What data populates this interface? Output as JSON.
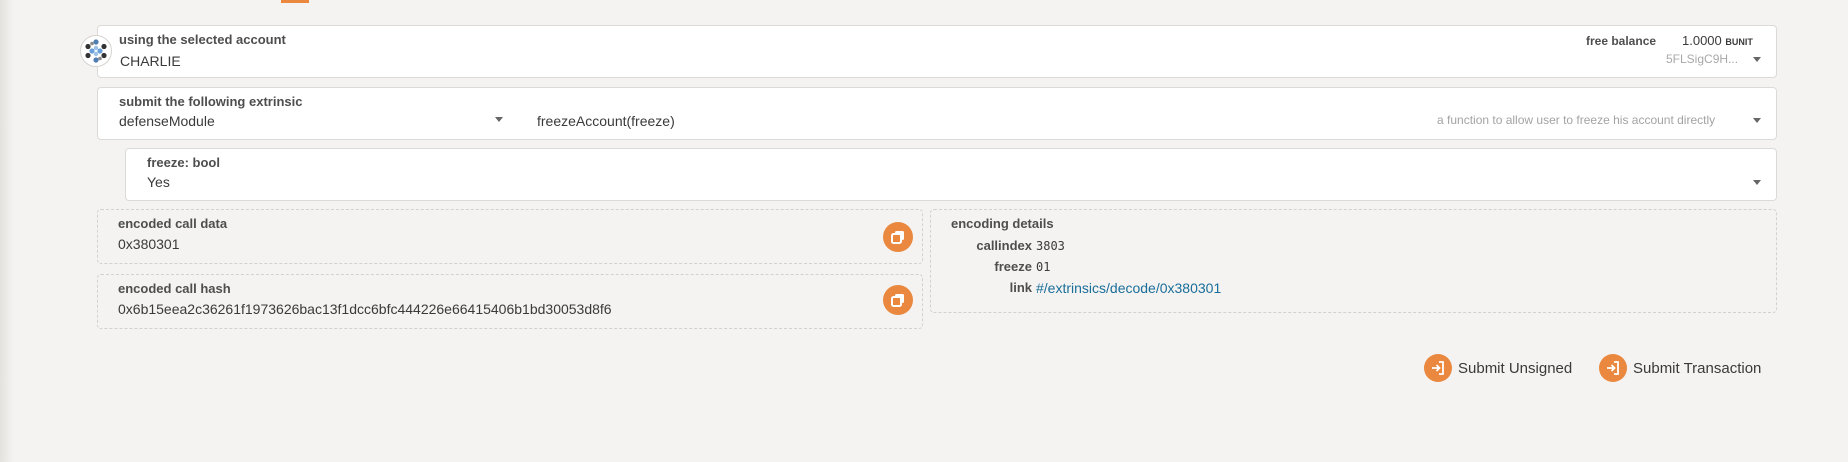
{
  "account": {
    "label": "using the selected account",
    "name": "CHARLIE",
    "free_balance_label": "free balance",
    "balance_value": "1.0000",
    "balance_unit": "BUNIT",
    "address_short": "5FLSigC9H..."
  },
  "extrinsic": {
    "label": "submit the following extrinsic",
    "module": "defenseModule",
    "method": "freezeAccount(freeze)",
    "description": "a function to allow user to freeze his account directly"
  },
  "param": {
    "label": "freeze: bool",
    "value": "Yes"
  },
  "encoded_call_data": {
    "label": "encoded call data",
    "value": "0x380301"
  },
  "encoded_call_hash": {
    "label": "encoded call hash",
    "value": "0x6b15eea2c36261f1973626bac13f1dcc6bfc444226e66415406b1bd30053d8f6"
  },
  "encoding_details": {
    "label": "encoding details",
    "rows": [
      {
        "key": "callindex",
        "value": "3803"
      },
      {
        "key": "freeze",
        "value": "01"
      },
      {
        "key": "link",
        "value": "#/extrinsics/decode/0x380301"
      }
    ]
  },
  "actions": {
    "submit_unsigned": "Submit Unsigned",
    "submit_transaction": "Submit Transaction"
  },
  "colors": {
    "accent": "#e9883e",
    "link": "#1a6e9a",
    "background": "#f4f3f1"
  },
  "icons": {
    "avatar": "identicon-avatar",
    "copy": "copy-icon",
    "submit": "sign-in-icon"
  }
}
